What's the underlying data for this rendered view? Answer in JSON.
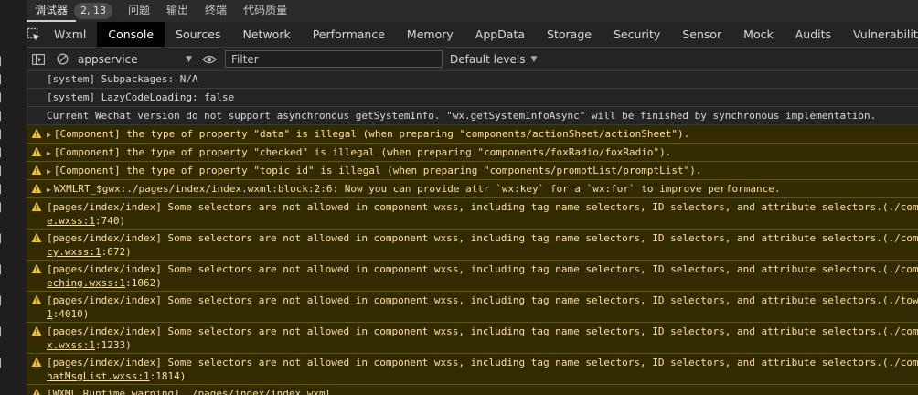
{
  "top_tabs": [
    {
      "label": "调试器",
      "active": true
    },
    {
      "label": "问题"
    },
    {
      "label": "输出"
    },
    {
      "label": "终端"
    },
    {
      "label": "代码质量"
    }
  ],
  "top_badge": "2, 13",
  "panel_tabs": [
    "Wxml",
    "Console",
    "Sources",
    "Network",
    "Performance",
    "Memory",
    "AppData",
    "Storage",
    "Security",
    "Sensor",
    "Mock",
    "Audits",
    "Vulnerability"
  ],
  "active_panel": "Console",
  "toolbar": {
    "context": "appservice",
    "filter_placeholder": "Filter",
    "levels": "Default levels"
  },
  "logs": [
    {
      "level": "info",
      "text": "[system] Subpackages: N/A"
    },
    {
      "level": "info",
      "text": "[system] LazyCodeLoading: false"
    },
    {
      "level": "info",
      "text": "Current Wechat version do not support asynchronous getSystemInfo. \"wx.getSystemInfoAsync\" will be finished by synchronous implementation."
    },
    {
      "level": "warn",
      "expandable": true,
      "text": "[Component] the type of property \"data\" is illegal (when preparing \"components/actionSheet/actionSheet\")."
    },
    {
      "level": "warn",
      "expandable": true,
      "text": "[Component] the type of property \"checked\" is illegal (when preparing \"components/foxRadio/foxRadio\")."
    },
    {
      "level": "warn",
      "expandable": true,
      "text": "[Component] the type of property \"topic_id\" is illegal (when preparing \"components/promptList/promptList\")."
    },
    {
      "level": "warn",
      "expandable": true,
      "text": "WXMLRT_$gwx:./pages/index/index.wxml:block:2:6: Now you can provide attr `wx:key` for a `wx:for` to improve performance."
    },
    {
      "level": "warn",
      "text": "[pages/index/index] Some selectors are not allowed in component wxss, including tag name selectors, ID selectors, and attribute selectors.(./comp",
      "line2_link": "e.wxss:1",
      "line2_rest": ":740)"
    },
    {
      "level": "warn",
      "text": "[pages/index/index] Some selectors are not allowed in component wxss, including tag name selectors, ID selectors, and attribute selectors.(./comp",
      "line2_link": "cy.wxss:1",
      "line2_rest": ":672)"
    },
    {
      "level": "warn",
      "text": "[pages/index/index] Some selectors are not allowed in component wxss, including tag name selectors, ID selectors, and attribute selectors.(./comp",
      "line2_link": "eching.wxss:1",
      "line2_rest": ":1062)"
    },
    {
      "level": "warn",
      "text": "[pages/index/index] Some selectors are not allowed in component wxss, including tag name selectors, ID selectors, and attribute selectors.(./towx",
      "line2_link": "1",
      "line2_rest": ":4010)"
    },
    {
      "level": "warn",
      "text": "[pages/index/index] Some selectors are not allowed in component wxss, including tag name selectors, ID selectors, and attribute selectors.(./comp",
      "line2_link": "x.wxss:1",
      "line2_rest": ":1233)"
    },
    {
      "level": "warn",
      "text": "[pages/index/index] Some selectors are not allowed in component wxss, including tag name selectors, ID selectors, and attribute selectors.(./comp",
      "line2_link": "hatMsgList.wxss:1",
      "line2_rest": ":1814)"
    },
    {
      "level": "warn",
      "text": "[WXML Runtime warning] ./pages/index/index.wxml"
    }
  ],
  "colors": {
    "background": "#242424",
    "warn_bg": "#332b00",
    "warn_text": "#ffdf9c",
    "warn_icon": "#f2c22b"
  }
}
